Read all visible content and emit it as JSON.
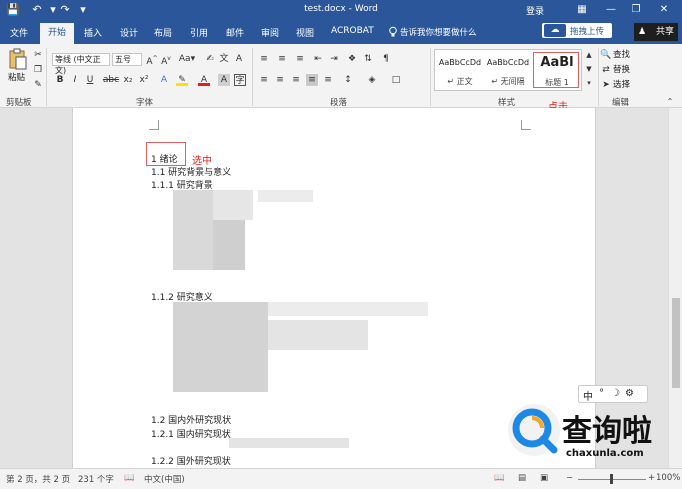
{
  "window": {
    "title": "test.docx - Word",
    "login_label": "登录",
    "sync_label": "拖拽上传",
    "share_label": "共享",
    "quick_access": [
      "save-icon",
      "undo-icon",
      "redo-icon",
      "customize-icon"
    ],
    "controls": [
      "ribbon-display-icon",
      "minimize-icon",
      "restore-icon",
      "close-icon"
    ]
  },
  "tabs": [
    {
      "label": "文件"
    },
    {
      "label": "开始"
    },
    {
      "label": "插入"
    },
    {
      "label": "设计"
    },
    {
      "label": "布局"
    },
    {
      "label": "引用"
    },
    {
      "label": "邮件"
    },
    {
      "label": "审阅"
    },
    {
      "label": "视图"
    },
    {
      "label": "ACROBAT"
    }
  ],
  "tell_me": "告诉我你想要做什么",
  "ribbon": {
    "clipboard": {
      "paste_label": "粘贴",
      "group_label": "剪贴板"
    },
    "font": {
      "font_name": "等线 (中文正文)",
      "font_size": "五号",
      "group_label": "字体",
      "buttons": [
        "B",
        "I",
        "U",
        "abc",
        "x₂",
        "x²",
        "A",
        "Aa",
        "wén",
        "A"
      ]
    },
    "paragraph": {
      "group_label": "段落"
    },
    "styles": {
      "group_label": "样式",
      "items": [
        {
          "sample": "AaBbCcDd",
          "name": "↵ 正文"
        },
        {
          "sample": "AaBbCcDd",
          "name": "↵ 无间隔"
        },
        {
          "sample": "AaBl",
          "name": "标题 1"
        }
      ]
    },
    "editing": {
      "group_label": "编辑",
      "find": "查找",
      "replace": "替换",
      "select": "选择"
    }
  },
  "document": {
    "paragraphs": [
      {
        "text": "1 绪论"
      },
      {
        "text": "1.1 研究背景与意义"
      },
      {
        "text": "1.1.1 研究背景"
      },
      {
        "text": "1.1.2 研究意义"
      },
      {
        "text": "1.2 国内外研究现状"
      },
      {
        "text": "1.2.1 国内研究现状"
      },
      {
        "text": "1.2.2 国外研究现状"
      }
    ],
    "annotation_select": "选中",
    "annotation_click": "点击"
  },
  "status": {
    "page": "第 2 页，共 2 页",
    "words": "231 个字",
    "language": "中文(中国)",
    "zoom": "100%"
  },
  "ime": {
    "label": "中"
  },
  "watermark": {
    "text": "查询啦",
    "url": "chaxunla.com"
  }
}
